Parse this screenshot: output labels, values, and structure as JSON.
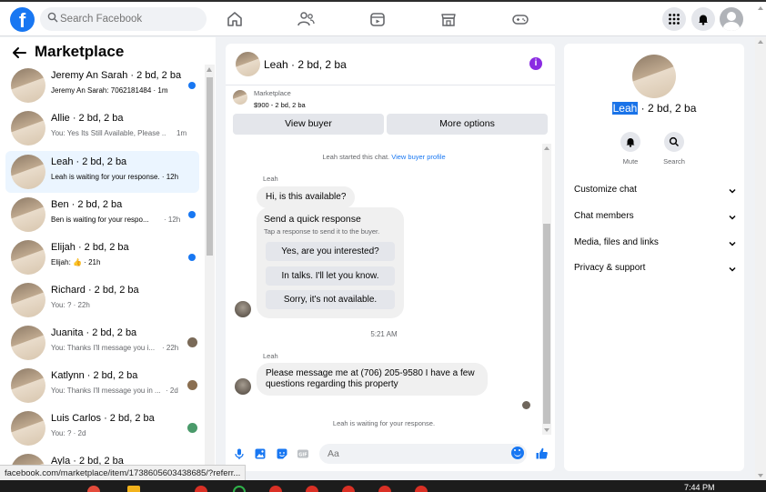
{
  "header": {
    "search_placeholder": "Search Facebook"
  },
  "sidebar": {
    "title": "Marketplace",
    "conversations": [
      {
        "name": "Jeremy An Sarah · 2 bd, 2 ba",
        "preview": "Jeremy An Sarah: 7062181484 · 1m",
        "time": "",
        "unread": true
      },
      {
        "name": "Allie · 2 bd, 2 ba",
        "preview": "You: Yes Its Still Available, Please ...",
        "time": "1m",
        "unread": false
      },
      {
        "name": "Leah · 2 bd, 2 ba",
        "preview": "Leah is waiting for your response. · 12h",
        "time": "",
        "unread": false
      },
      {
        "name": "Ben · 2 bd, 2 ba",
        "preview": "Ben is waiting for your respo...",
        "time": "· 12h",
        "unread": true
      },
      {
        "name": "Elijah · 2 bd, 2 ba",
        "preview": "Elijah: 👍 · 21h",
        "time": "",
        "unread": true
      },
      {
        "name": "Richard · 2 bd, 2 ba",
        "preview": "You: ? · 22h",
        "time": "",
        "unread": false
      },
      {
        "name": "Juanita · 2 bd, 2 ba",
        "preview": "You: Thanks I'll message you i...",
        "time": "· 22h",
        "unread": false
      },
      {
        "name": "Katlynn · 2 bd, 2 ba",
        "preview": "You: Thanks I'll message you in ...",
        "time": "· 2d",
        "unread": false
      },
      {
        "name": "Luis Carlos · 2 bd, 2 ba",
        "preview": "You: ? · 2d",
        "time": "",
        "unread": false
      },
      {
        "name": "Ayla · 2 bd, 2 ba",
        "preview": "",
        "time": "",
        "unread": false
      }
    ]
  },
  "chat": {
    "title": "Leah · 2 bd, 2 ba",
    "listing_source": "Marketplace",
    "listing_desc": "$900 - 2 bd, 2 ba",
    "view_buyer": "View buyer",
    "more_options": "More options",
    "started_text": "Leah started this chat.",
    "view_profile_link": "View buyer profile",
    "sender_1": "Leah",
    "message_1": "Hi, is this available?",
    "quick_title": "Send a quick response",
    "quick_subtitle": "Tap a response to send it to the buyer.",
    "quick_options": [
      "Yes, are you interested?",
      "In talks. I'll let you know.",
      "Sorry, it's not available."
    ],
    "timestamp": "5:21 AM",
    "sender_2": "Leah",
    "message_2": "Please message me at (706) 205-9580 I have a few questions regarding this property",
    "waiting_text": "Leah is waiting for your response.",
    "composer_placeholder": "Aa"
  },
  "details": {
    "name_highlight": "Leah",
    "name_rest": " · 2 bd, 2 ba",
    "mute_label": "Mute",
    "search_label": "Search",
    "menu": [
      "Customize chat",
      "Chat members",
      "Media, files and links",
      "Privacy & support"
    ]
  },
  "status_url": "facebook.com/marketplace/item/1738605603438685/?referr...",
  "clock": "7:44 PM",
  "colors": {
    "brand": "#1877f2",
    "info": "#8a2be2"
  }
}
